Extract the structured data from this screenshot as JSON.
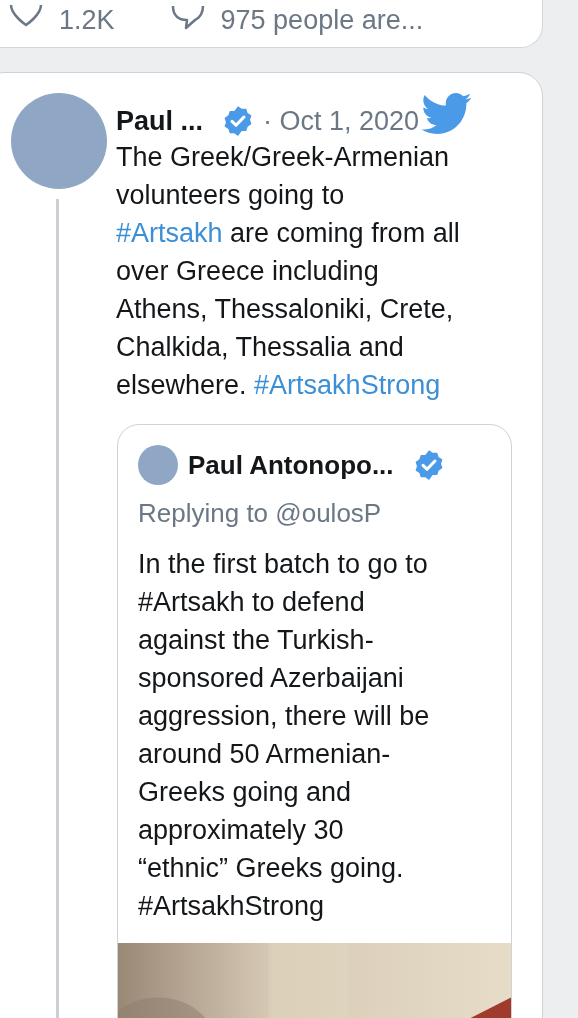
{
  "previous_tweet": {
    "likes": "1.2K",
    "replies": "975 people are..."
  },
  "tweet": {
    "author": "Paul ...",
    "verified": true,
    "date": "· Oct 1, 2020",
    "lines": [
      [
        {
          "kind": "text",
          "text": "The Greek/Greek-Armenian"
        }
      ],
      [
        {
          "kind": "text",
          "text": "volunteers going to"
        }
      ],
      [
        {
          "kind": "hashtag",
          "text": "#Artsakh"
        },
        {
          "kind": "text",
          "text": " are coming from all"
        }
      ],
      [
        {
          "kind": "text",
          "text": "over Greece including"
        }
      ],
      [
        {
          "kind": "text",
          "text": "Athens, Thessaloniki, Crete,"
        }
      ],
      [
        {
          "kind": "text",
          "text": "Chalkida, Thessalia and"
        }
      ],
      [
        {
          "kind": "text",
          "text": "elsewhere. "
        },
        {
          "kind": "hashtag",
          "text": "#ArtsakhStrong"
        }
      ]
    ],
    "quoted": {
      "author": "Paul Antonopo...",
      "verified": true,
      "replying_to": "Replying to @oulosP",
      "lines": [
        "In the first batch to go to",
        "#Artsakh to defend",
        "against the Turkish-",
        "sponsored Azerbaijani",
        "aggression, there will be",
        "around 50 Armenian-",
        "Greeks going and",
        "approximately 30",
        "“ethnic” Greeks going.",
        "#ArtsakhStrong"
      ]
    }
  }
}
